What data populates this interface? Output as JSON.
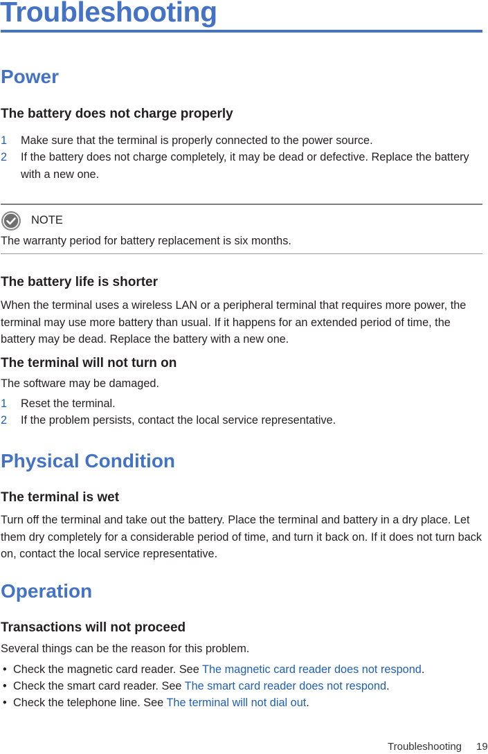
{
  "page": {
    "title": "Troubleshooting",
    "accent_color": "#4472c4",
    "link_color": "#1f5fb0"
  },
  "sections": {
    "power": {
      "heading": "Power",
      "battery_charge": {
        "heading": "The battery does not charge properly",
        "steps": [
          {
            "num": "1",
            "text": "Make sure that the terminal is properly connected to the power source."
          },
          {
            "num": "2",
            "text": "If the battery does not charge completely, it may be dead or defective. Replace the battery with a new one."
          }
        ]
      },
      "note": {
        "icon": "check-circle-icon",
        "label": "NOTE",
        "text": "The warranty period for battery replacement is six months."
      },
      "battery_life": {
        "heading": "The battery life is shorter",
        "body": "When the terminal uses a wireless LAN or a peripheral terminal that requires more power, the terminal may use more battery than usual. If it happens for an extended period of time, the battery may be dead. Replace the battery with a new one."
      },
      "no_turn_on": {
        "heading": "The terminal will not turn on",
        "body": "The software may be damaged.",
        "steps": [
          {
            "num": "1",
            "text": "Reset the terminal."
          },
          {
            "num": "2",
            "text": "If the problem persists, contact the local service representative."
          }
        ]
      }
    },
    "physical": {
      "heading": "Physical Condition",
      "wet": {
        "heading": "The terminal is wet",
        "body": "Turn off the terminal and take out the battery. Place the terminal and battery in a dry place. Let them dry completely for a considerable period of time, and turn it back on. If it does not turn back on, contact the local service representative."
      }
    },
    "operation": {
      "heading": "Operation",
      "transactions": {
        "heading": "Transactions will not proceed",
        "body": "Several things can be the reason for this problem.",
        "bullets": [
          {
            "prefix": "Check the magnetic card reader. See ",
            "link": "The magnetic card reader does not respond",
            "suffix": "."
          },
          {
            "prefix": "Check the smart card reader. See ",
            "link": "The smart card reader does not respond",
            "suffix": "."
          },
          {
            "prefix": "Check the telephone line. See ",
            "link": "The terminal will not dial out",
            "suffix": "."
          }
        ]
      }
    }
  },
  "footer": {
    "section": "Troubleshooting",
    "page_number": "19"
  }
}
